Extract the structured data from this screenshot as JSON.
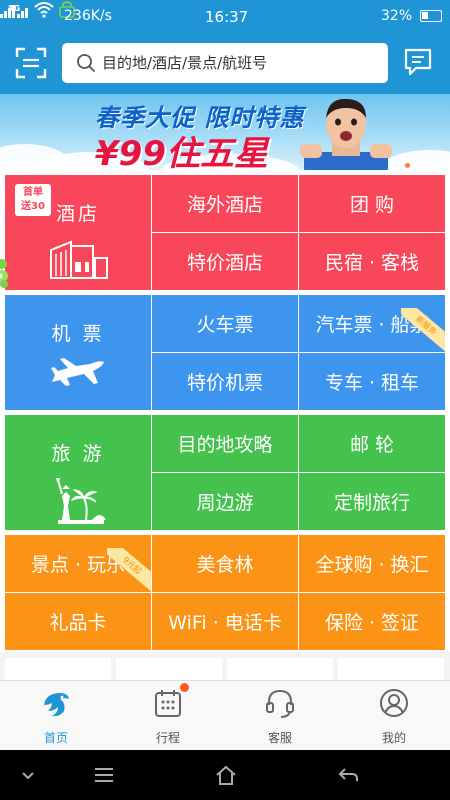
{
  "status_bar": {
    "network_top": "4G",
    "network_bottom": "2G",
    "speed": "236K/s",
    "time": "16:37",
    "battery": "32%"
  },
  "header": {
    "search_placeholder": "目的地/酒店/景点/航班号",
    "icons": [
      "scan-icon",
      "search-icon",
      "message-icon"
    ]
  },
  "banner": {
    "line1": "春季大促 限时特惠",
    "line2": "¥99住五星"
  },
  "grid": {
    "hotel": {
      "label": "酒店",
      "badge": "首单送30",
      "badge_line1": "首单",
      "badge_line2": "送30"
    },
    "overseas_hotel": "海外酒店",
    "group_buy": "团 购",
    "special_hotel": "特价酒店",
    "homestay": "民宿 · 客栈",
    "flight": {
      "label": "机 票"
    },
    "train": "火车票",
    "bus_ship": "汽车票 · 船票",
    "bus_ship_badge": "新服务",
    "special_flight": "特价机票",
    "car": "专车 · 租车",
    "travel": {
      "label": "旅 游"
    },
    "destination_guide": "目的地攻略",
    "cruise": "邮 轮",
    "nearby": "周边游",
    "custom_travel": "定制旅行",
    "attractions": "景点 · 玩乐",
    "attractions_badge": "9元起",
    "food": "美食林",
    "global_shop": "全球购 · 换汇",
    "gift_card": "礼品卡",
    "wifi": "WiFi · 电话卡",
    "insurance": "保险 · 签证"
  },
  "tabbar": {
    "home": "首页",
    "trips": "行程",
    "service": "客服",
    "mine": "我的"
  },
  "colors": {
    "brand_blue": "#1f95d6",
    "red": "#f8475a",
    "blue": "#3d95ee",
    "green": "#44c24d",
    "orange": "#fa9316"
  }
}
